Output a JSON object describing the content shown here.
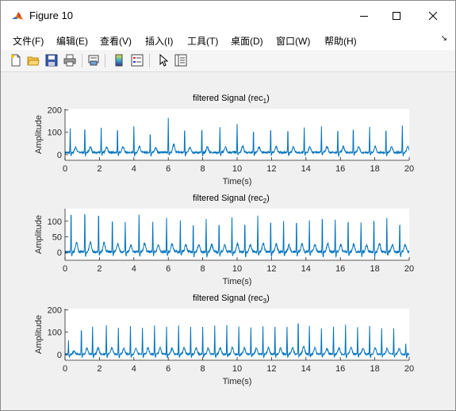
{
  "window": {
    "title": "Figure 10"
  },
  "menu": [
    "文件(F)",
    "编辑(E)",
    "查看(V)",
    "插入(I)",
    "工具(T)",
    "桌面(D)",
    "窗口(W)",
    "帮助(H)"
  ],
  "toolbar": [
    "new-figure-icon",
    "open-file-icon",
    "save-icon",
    "print-icon",
    "link-plot-icon",
    "colorbar-icon",
    "legend-icon",
    "pointer-icon",
    "property-inspector-icon"
  ],
  "colors": {
    "line": "#0072BD",
    "axes_bg": "#ffffff",
    "figure_bg": "#f0f0f0"
  },
  "chart_data": [
    {
      "type": "line",
      "title": "filtered Signal (rec",
      "title_sub": "1",
      "title_close": ")",
      "xlabel": "Time(s)",
      "ylabel": "Amplitude",
      "xlim": [
        0,
        20
      ],
      "ylim": [
        -25,
        205
      ],
      "xticks": [
        0,
        2,
        4,
        6,
        8,
        10,
        12,
        14,
        16,
        18,
        20
      ],
      "yticks": [
        0,
        100,
        200
      ],
      "grid": false,
      "series": [
        {
          "baseline": 10,
          "beats": [
            {
              "t": 0.3,
              "peak": 105
            },
            {
              "t": 1.15,
              "peak": 120
            },
            {
              "t": 2.1,
              "peak": 108
            },
            {
              "t": 3.05,
              "peak": 120
            },
            {
              "t": 4.0,
              "peak": 120
            },
            {
              "t": 4.95,
              "peak": 98
            },
            {
              "t": 6.0,
              "peak": 155
            },
            {
              "t": 6.95,
              "peak": 112
            },
            {
              "t": 7.95,
              "peak": 115
            },
            {
              "t": 9.0,
              "peak": 112
            },
            {
              "t": 10.0,
              "peak": 128
            },
            {
              "t": 10.95,
              "peak": 112
            },
            {
              "t": 11.95,
              "peak": 118
            },
            {
              "t": 12.95,
              "peak": 110
            },
            {
              "t": 13.9,
              "peak": 115
            },
            {
              "t": 14.9,
              "peak": 120
            },
            {
              "t": 15.85,
              "peak": 118
            },
            {
              "t": 16.75,
              "peak": 122
            },
            {
              "t": 17.7,
              "peak": 118
            },
            {
              "t": 18.65,
              "peak": 112
            },
            {
              "t": 19.6,
              "peak": 118
            }
          ]
        }
      ]
    },
    {
      "type": "line",
      "title": "filtered Signal (rec",
      "title_sub": "2",
      "title_close": ")",
      "xlabel": "Time(s)",
      "ylabel": "Amplitude",
      "xlim": [
        0,
        20
      ],
      "ylim": [
        -25,
        140
      ],
      "xticks": [
        0,
        2,
        4,
        6,
        8,
        10,
        12,
        14,
        16,
        18,
        20
      ],
      "yticks": [
        0,
        50,
        100
      ],
      "grid": false,
      "series": [
        {
          "baseline": 2,
          "beats": [
            {
              "t": 0.35,
              "peak": 140
            },
            {
              "t": 1.15,
              "peak": 140
            },
            {
              "t": 1.95,
              "peak": 135
            },
            {
              "t": 2.75,
              "peak": 118
            },
            {
              "t": 3.5,
              "peak": 100
            },
            {
              "t": 4.3,
              "peak": 120
            },
            {
              "t": 5.1,
              "peak": 100
            },
            {
              "t": 5.9,
              "peak": 112
            },
            {
              "t": 6.7,
              "peak": 102
            },
            {
              "t": 7.45,
              "peak": 100
            },
            {
              "t": 8.2,
              "peak": 108
            },
            {
              "t": 8.95,
              "peak": 100
            },
            {
              "t": 9.7,
              "peak": 115
            },
            {
              "t": 10.45,
              "peak": 102
            },
            {
              "t": 11.2,
              "peak": 118
            },
            {
              "t": 11.95,
              "peak": 112
            },
            {
              "t": 12.7,
              "peak": 98
            },
            {
              "t": 13.45,
              "peak": 115
            },
            {
              "t": 14.2,
              "peak": 100
            },
            {
              "t": 14.95,
              "peak": 120
            },
            {
              "t": 15.7,
              "peak": 108
            },
            {
              "t": 16.45,
              "peak": 110
            },
            {
              "t": 17.2,
              "peak": 98
            },
            {
              "t": 17.95,
              "peak": 118
            },
            {
              "t": 18.7,
              "peak": 108
            },
            {
              "t": 19.45,
              "peak": 100
            }
          ]
        }
      ]
    },
    {
      "type": "line",
      "title": "filtered Signal (rec",
      "title_sub": "3",
      "title_close": ")",
      "xlabel": "Time(s)",
      "ylabel": "Amplitude",
      "xlim": [
        0,
        20
      ],
      "ylim": [
        -25,
        205
      ],
      "xticks": [
        0,
        2,
        4,
        6,
        8,
        10,
        12,
        14,
        16,
        18,
        20
      ],
      "yticks": [
        0,
        100,
        200
      ],
      "grid": false,
      "series": [
        {
          "baseline": 2,
          "beats": [
            {
              "t": 0.2,
              "peak": 60
            },
            {
              "t": 0.95,
              "peak": 125
            },
            {
              "t": 1.6,
              "peak": 125
            },
            {
              "t": 2.4,
              "peak": 130
            },
            {
              "t": 3.1,
              "peak": 120
            },
            {
              "t": 3.8,
              "peak": 130
            },
            {
              "t": 4.5,
              "peak": 120
            },
            {
              "t": 5.2,
              "peak": 125
            },
            {
              "t": 5.9,
              "peak": 120
            },
            {
              "t": 6.6,
              "peak": 125
            },
            {
              "t": 7.3,
              "peak": 120
            },
            {
              "t": 8.0,
              "peak": 125
            },
            {
              "t": 8.7,
              "peak": 125
            },
            {
              "t": 9.4,
              "peak": 130
            },
            {
              "t": 10.1,
              "peak": 125
            },
            {
              "t": 10.8,
              "peak": 120
            },
            {
              "t": 11.5,
              "peak": 125
            },
            {
              "t": 12.2,
              "peak": 120
            },
            {
              "t": 12.9,
              "peak": 125
            },
            {
              "t": 13.55,
              "peak": 160
            },
            {
              "t": 14.2,
              "peak": 125
            },
            {
              "t": 14.9,
              "peak": 120
            },
            {
              "t": 15.6,
              "peak": 125
            },
            {
              "t": 16.3,
              "peak": 130
            },
            {
              "t": 17.0,
              "peak": 120
            },
            {
              "t": 17.7,
              "peak": 125
            },
            {
              "t": 18.4,
              "peak": 120
            },
            {
              "t": 19.1,
              "peak": 115
            },
            {
              "t": 19.8,
              "peak": 50
            }
          ]
        }
      ]
    }
  ]
}
